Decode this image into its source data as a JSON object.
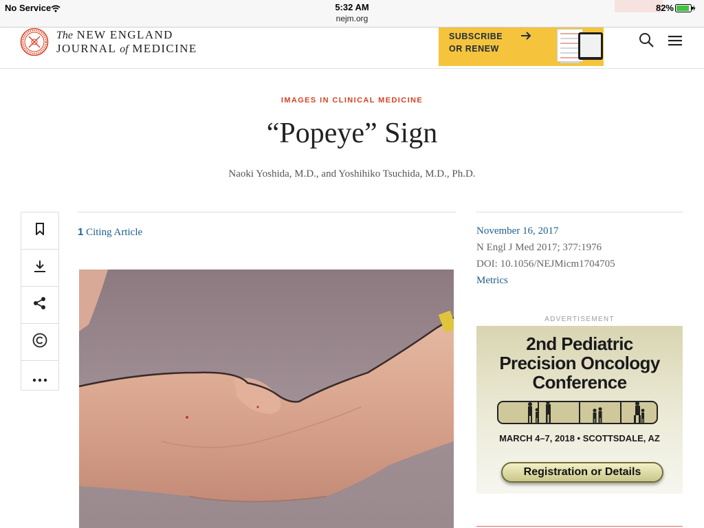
{
  "status_bar": {
    "carrier": "No Service",
    "time": "5:32 AM",
    "url": "nejm.org",
    "battery": "82%",
    "wifi_icon": "wifi-icon",
    "battery_icon": "battery-charging-icon"
  },
  "header": {
    "masthead_the": "The",
    "masthead_line1": "NEW ENGLAND",
    "masthead_line2a": "JOURNAL",
    "masthead_of": "of",
    "masthead_line2b": "MEDICINE",
    "promo_line1": "SUBSCRIBE",
    "promo_line2": "OR RENEW",
    "icons": [
      "nejm-seal-logo",
      "arrow-right-icon",
      "search-icon",
      "hamburger-menu-icon"
    ],
    "brand_color": "#d64123",
    "promo_color": "#f5c43c"
  },
  "article": {
    "category": "IMAGES IN CLINICAL MEDICINE",
    "title": "“Popeye” Sign",
    "authors": "Naoki Yoshida, M.D., and Yoshihiko Tsuchida, M.D., Ph.D.",
    "citing_count": "1",
    "citing_label": "Citing Article",
    "link_color": "#1d5e8f"
  },
  "tools": [
    "bookmark-icon",
    "download-icon",
    "share-icon",
    "copyright-icon",
    "more-icon"
  ],
  "meta": {
    "date": "November 16, 2017",
    "citation": "N Engl J Med 2017; 377:1976",
    "doi": "DOI: 10.1056/NEJMicm1704705",
    "metrics": "Metrics"
  },
  "ad": {
    "label": "ADVERTISEMENT",
    "title_line1": "2nd Pediatric",
    "title_line2": "Precision Oncology",
    "title_line3": "Conference",
    "dates": "MARCH 4–7, 2018 • SCOTTSDALE, AZ",
    "button": "Registration or Details"
  }
}
